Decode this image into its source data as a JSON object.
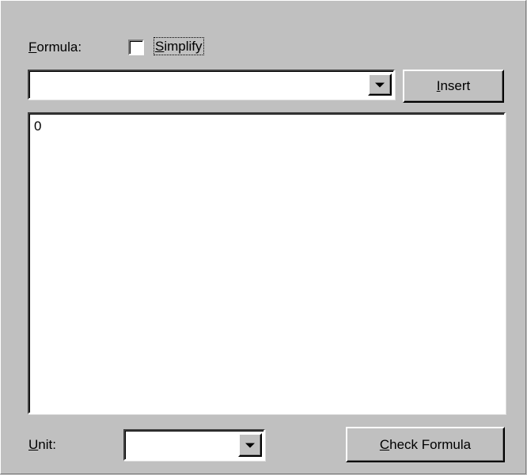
{
  "formula": {
    "label_prefix": "F",
    "label_rest": "ormula:",
    "simplify": {
      "checked": false,
      "label_prefix": "S",
      "label_rest": "implify"
    },
    "combo_value": "",
    "insert_button": {
      "label_prefix": "I",
      "label_rest": "nsert"
    },
    "editor_text": "0"
  },
  "unit": {
    "label_prefix": "U",
    "label_rest": "nit:",
    "combo_value": ""
  },
  "check_button": {
    "label_prefix": "C",
    "label_rest": "heck Formula"
  },
  "icons": {
    "dropdown": "chevron-down-icon"
  }
}
